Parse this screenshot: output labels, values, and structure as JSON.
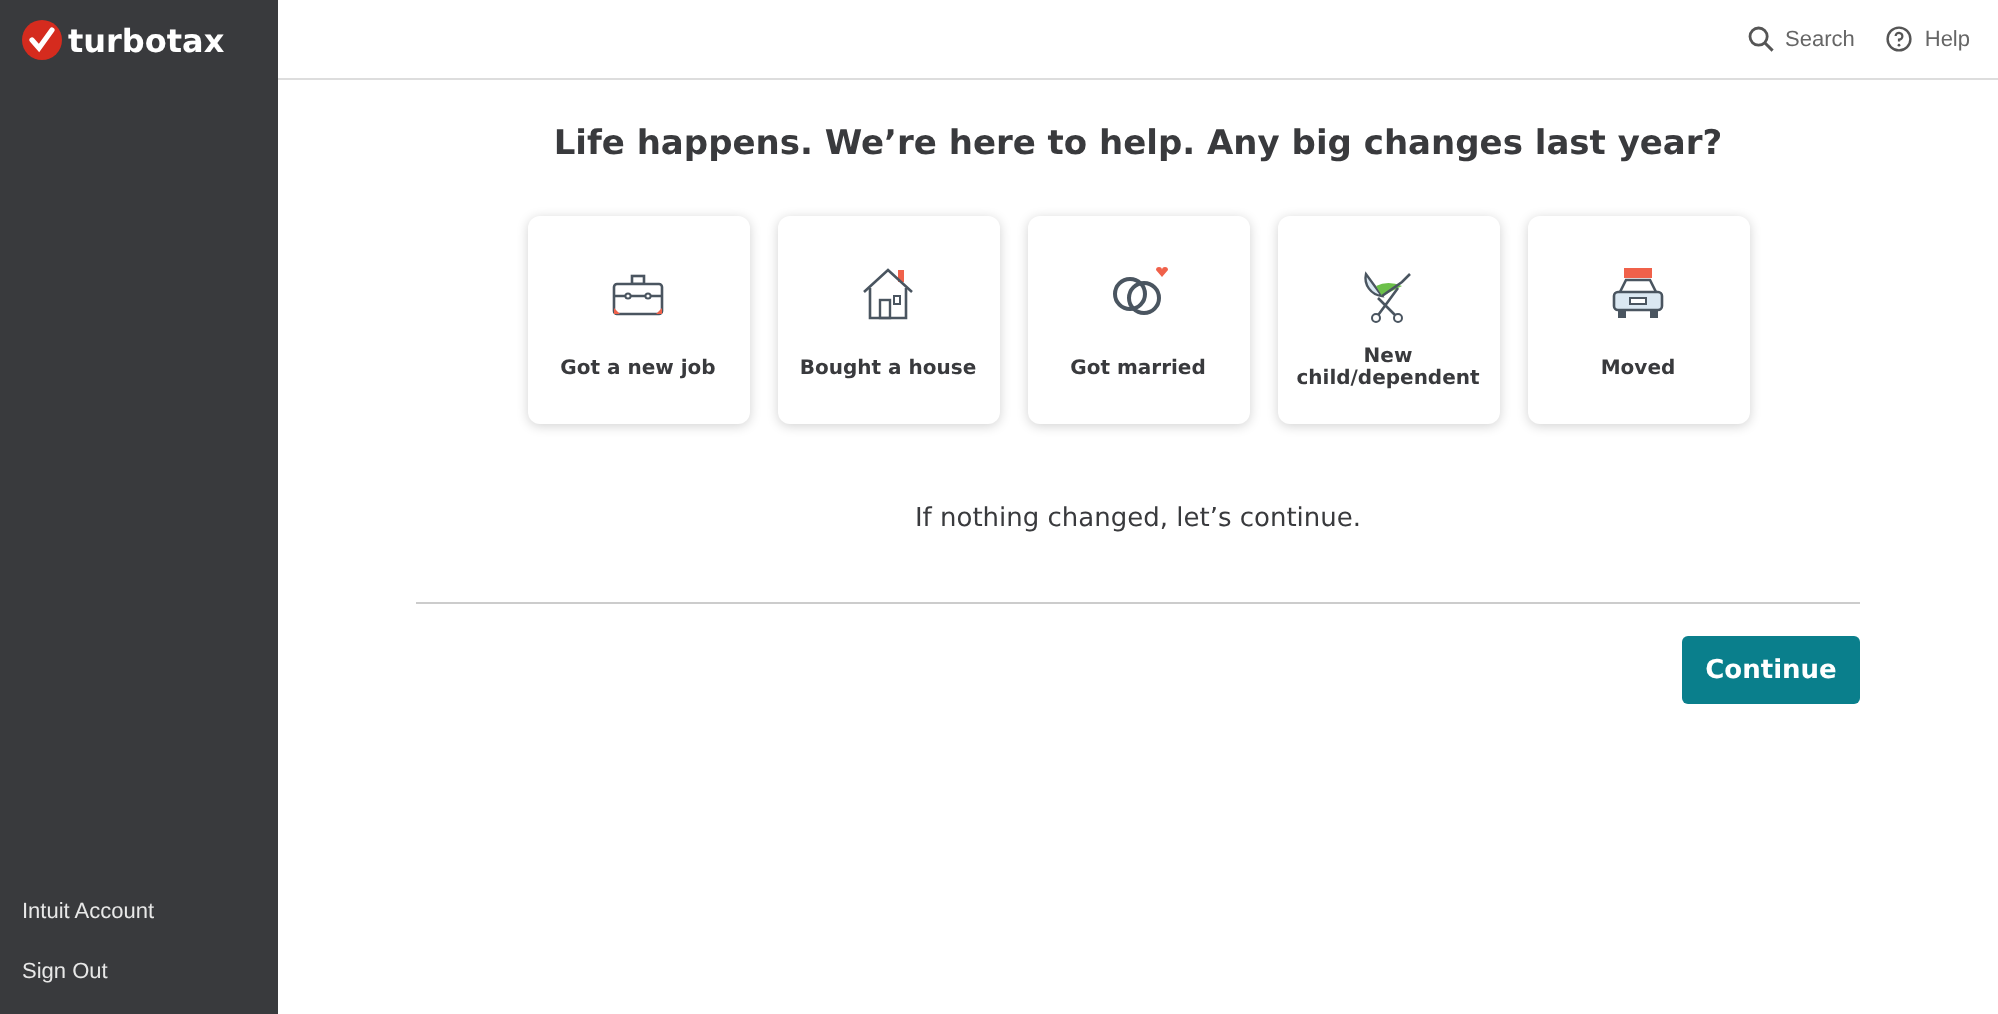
{
  "sidebar": {
    "logo": "turbotax",
    "items": [
      "Intuit Account",
      "Sign Out"
    ]
  },
  "header": {
    "search": "Search",
    "help": "Help"
  },
  "title": "Life happens. We’re here to help. Any big changes last year?",
  "cards": [
    {
      "kind": "job",
      "label": "Got a new job"
    },
    {
      "kind": "house",
      "label": "Bought a house"
    },
    {
      "kind": "married",
      "label": "Got married"
    },
    {
      "kind": "child",
      "label": "New child/dependent"
    },
    {
      "kind": "moved",
      "label": "Moved"
    }
  ],
  "note": "If nothing changed, let’s continue.",
  "continue_button": "Continue"
}
